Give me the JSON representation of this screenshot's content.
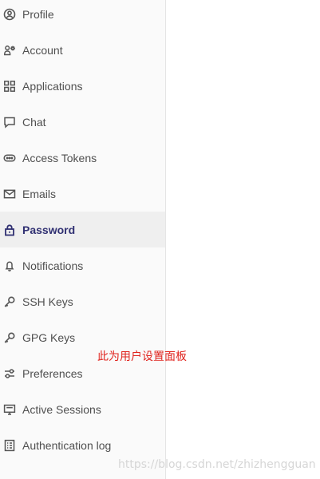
{
  "sidebar": {
    "items": [
      {
        "label": "Profile",
        "icon": "profile-icon",
        "active": false
      },
      {
        "label": "Account",
        "icon": "account-settings-icon",
        "active": false
      },
      {
        "label": "Applications",
        "icon": "applications-icon",
        "active": false
      },
      {
        "label": "Chat",
        "icon": "chat-icon",
        "active": false
      },
      {
        "label": "Access Tokens",
        "icon": "access-token-icon",
        "active": false
      },
      {
        "label": "Emails",
        "icon": "mail-icon",
        "active": false
      },
      {
        "label": "Password",
        "icon": "lock-icon",
        "active": true
      },
      {
        "label": "Notifications",
        "icon": "notifications-icon",
        "active": false
      },
      {
        "label": "SSH Keys",
        "icon": "key-icon",
        "active": false
      },
      {
        "label": "GPG Keys",
        "icon": "key-icon",
        "active": false
      },
      {
        "label": "Preferences",
        "icon": "preferences-icon",
        "active": false
      },
      {
        "label": "Active Sessions",
        "icon": "monitor-icon",
        "active": false
      },
      {
        "label": "Authentication log",
        "icon": "log-icon",
        "active": false
      }
    ]
  },
  "annotation": {
    "text": "此为用户设置面板",
    "color": "#e0251f"
  },
  "watermark": {
    "text": "https://blog.csdn.net/zhizhengguan"
  },
  "colors": {
    "active_text": "#303072",
    "sidebar_background": "#fafafa",
    "active_background": "#efefef"
  }
}
